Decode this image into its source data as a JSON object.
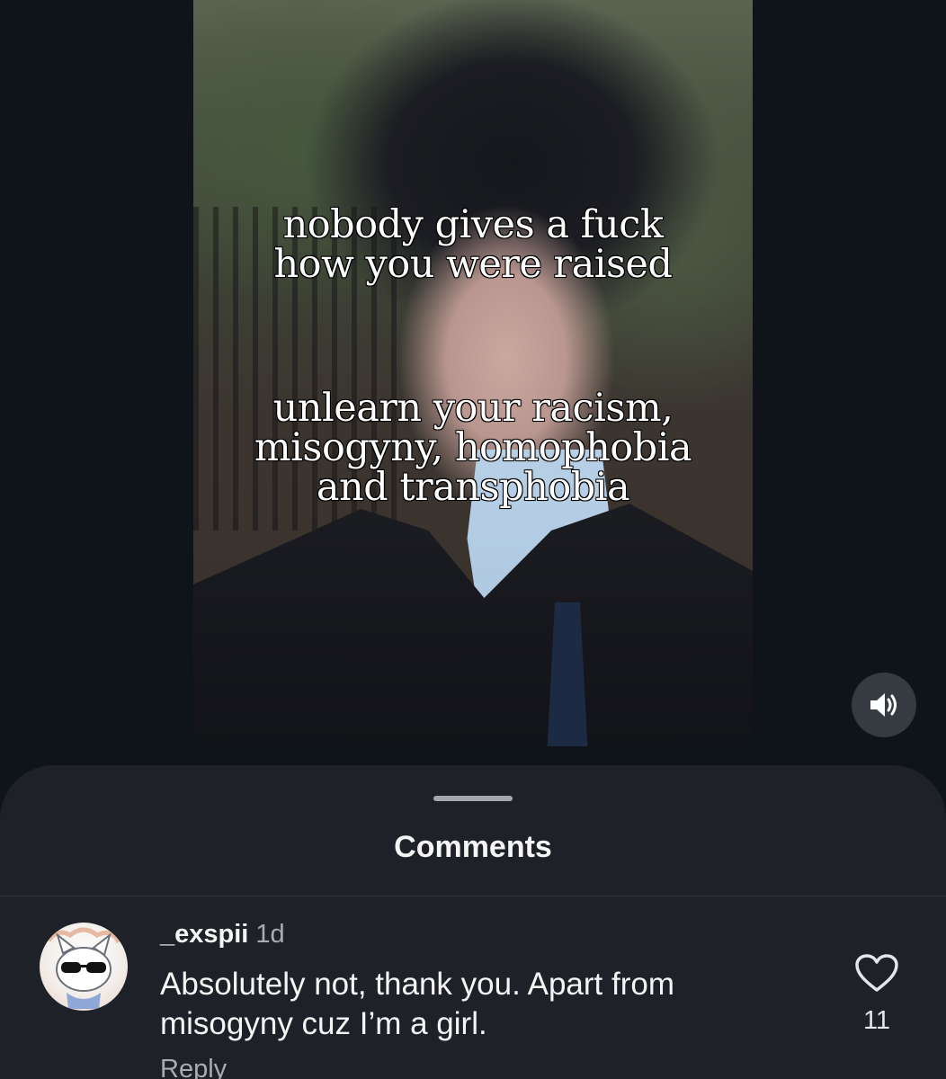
{
  "reel": {
    "overlay_lines_top": [
      "nobody gives a fuck",
      "how you were raised"
    ],
    "overlay_lines_bottom": [
      "unlearn your racism,",
      "misogyny, homophobia",
      "and transphobia"
    ],
    "sound_icon": "speaker-on-icon"
  },
  "comments_sheet": {
    "title": "Comments",
    "comment": {
      "username": "_exspii",
      "time": "1d",
      "text_line1": "Absolutely not, thank you. Apart from",
      "text_line2": "misogyny cuz I’m a girl.",
      "reply_label": "Reply",
      "like_count": "11",
      "like_icon": "heart-outline-icon",
      "avatar_icon": "cat-with-sunglasses-avatar"
    }
  },
  "colors": {
    "background": "#0f141b",
    "sheet": "#1e2127",
    "secondary_text": "#a8adb4"
  }
}
